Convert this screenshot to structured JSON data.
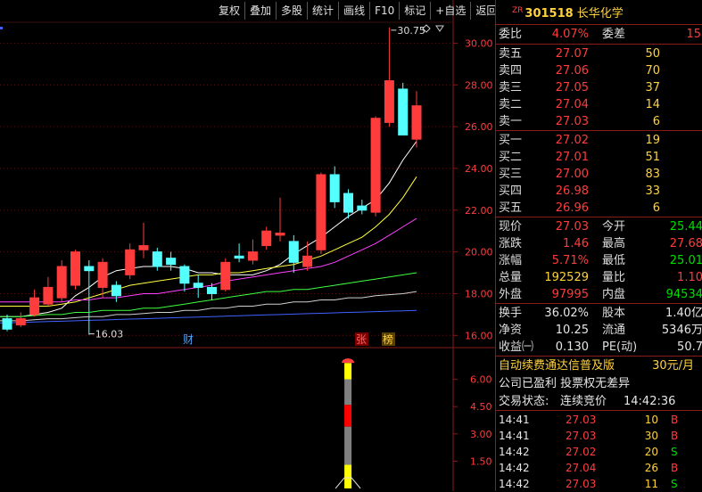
{
  "toolbar": {
    "buttons": [
      "复权",
      "叠加",
      "多股",
      "统计",
      "画线",
      "F10",
      "标记",
      "+自选",
      "返回"
    ]
  },
  "chart": {
    "price_labels": [
      "30.00",
      "28.00",
      "26.00",
      "24.00",
      "22.00",
      "20.00",
      "18.00",
      "16.00"
    ],
    "high_label": "30.75",
    "low_label": "16.03",
    "markers": [
      "财",
      "张",
      "榜"
    ],
    "indicator_labels": [
      "6.00",
      "4.50",
      "3.00",
      "1.50"
    ]
  },
  "stock": {
    "zr": "ZR",
    "code": "301518",
    "name": "长华化学"
  },
  "weibi": {
    "label": "委比",
    "value": "4.07%",
    "label2": "委差",
    "value2": "15"
  },
  "asks": [
    {
      "label": "卖五",
      "price": "27.07",
      "vol": "50"
    },
    {
      "label": "卖四",
      "price": "27.06",
      "vol": "70"
    },
    {
      "label": "卖三",
      "price": "27.05",
      "vol": "37"
    },
    {
      "label": "卖二",
      "price": "27.04",
      "vol": "14"
    },
    {
      "label": "卖一",
      "price": "27.03",
      "vol": "6"
    }
  ],
  "bids": [
    {
      "label": "买一",
      "price": "27.02",
      "vol": "19"
    },
    {
      "label": "买二",
      "price": "27.01",
      "vol": "51"
    },
    {
      "label": "买三",
      "price": "27.00",
      "vol": "83"
    },
    {
      "label": "买四",
      "price": "26.98",
      "vol": "33"
    },
    {
      "label": "买五",
      "price": "26.96",
      "vol": "6"
    }
  ],
  "quote": [
    {
      "l1": "现价",
      "v1": "27.03",
      "c1": "red",
      "l2": "今开",
      "v2": "25.44",
      "c2": "green"
    },
    {
      "l1": "涨跌",
      "v1": "1.46",
      "c1": "red",
      "l2": "最高",
      "v2": "27.68",
      "c2": "red"
    },
    {
      "l1": "涨幅",
      "v1": "5.71%",
      "c1": "red",
      "l2": "最低",
      "v2": "25.01",
      "c2": "green"
    },
    {
      "l1": "总量",
      "v1": "192529",
      "c1": "yellow",
      "l2": "量比",
      "v2": "1.10",
      "c2": "red"
    },
    {
      "l1": "外盘",
      "v1": "97995",
      "c1": "red",
      "l2": "内盘",
      "v2": "94534",
      "c2": "green"
    }
  ],
  "fundamentals": [
    {
      "l1": "换手",
      "v1": "36.02%",
      "l2": "股本",
      "v2": "1.40亿"
    },
    {
      "l1": "净资",
      "v1": "10.25",
      "l2": "流通",
      "v2": "5346万"
    },
    {
      "l1": "收益㈠",
      "v1": "0.130",
      "l2": "PE(动)",
      "v2": "50.7"
    }
  ],
  "promo": {
    "text": "自动续费通达信普及版",
    "price": "30元/月"
  },
  "company_note": "公司已盈利 投票权无差异",
  "trade_status": {
    "label": "交易状态:",
    "status": "连续竞价",
    "time": "14:42:36"
  },
  "ticks": [
    {
      "time": "14:41",
      "price": "27.03",
      "vol": "10",
      "bs": "B",
      "bs_color": "red"
    },
    {
      "time": "14:41",
      "price": "27.03",
      "vol": "30",
      "bs": "B",
      "bs_color": "red"
    },
    {
      "time": "14:42",
      "price": "27.02",
      "vol": "20",
      "bs": "S",
      "bs_color": "green"
    },
    {
      "time": "14:42",
      "price": "27.04",
      "vol": "26",
      "bs": "B",
      "bs_color": "red"
    },
    {
      "time": "14:42",
      "price": "27.03",
      "vol": "11",
      "bs": "S",
      "bs_color": "green"
    }
  ],
  "chart_data": {
    "type": "candlestick",
    "ylim": [
      15.5,
      31
    ],
    "candles": [
      {
        "o": 16.8,
        "c": 16.3,
        "h": 17.0,
        "l": 16.2
      },
      {
        "o": 16.5,
        "c": 16.8,
        "h": 17.1,
        "l": 16.4
      },
      {
        "o": 17.0,
        "c": 17.8,
        "h": 18.2,
        "l": 16.9
      },
      {
        "o": 17.5,
        "c": 18.3,
        "h": 18.8,
        "l": 17.4
      },
      {
        "o": 17.8,
        "c": 19.3,
        "h": 19.6,
        "l": 17.6
      },
      {
        "o": 18.4,
        "c": 20.0,
        "h": 20.1,
        "l": 18.2
      },
      {
        "o": 19.3,
        "c": 19.1,
        "h": 19.6,
        "l": 16.03
      },
      {
        "o": 18.3,
        "c": 19.5,
        "h": 19.7,
        "l": 17.8
      },
      {
        "o": 18.4,
        "c": 17.9,
        "h": 18.6,
        "l": 17.6
      },
      {
        "o": 18.9,
        "c": 20.1,
        "h": 20.4,
        "l": 18.7
      },
      {
        "o": 20.1,
        "c": 20.3,
        "h": 21.4,
        "l": 19.7
      },
      {
        "o": 20.0,
        "c": 19.3,
        "h": 20.2,
        "l": 19.1
      },
      {
        "o": 19.7,
        "c": 19.4,
        "h": 20.0,
        "l": 19.1
      },
      {
        "o": 19.3,
        "c": 18.5,
        "h": 19.4,
        "l": 18.1
      },
      {
        "o": 18.5,
        "c": 18.3,
        "h": 18.9,
        "l": 17.8
      },
      {
        "o": 18.3,
        "c": 18.0,
        "h": 18.5,
        "l": 17.7
      },
      {
        "o": 18.2,
        "c": 19.5,
        "h": 19.7,
        "l": 18.1
      },
      {
        "o": 19.8,
        "c": 19.7,
        "h": 20.4,
        "l": 19.5
      },
      {
        "o": 19.6,
        "c": 20.0,
        "h": 20.6,
        "l": 19.4
      },
      {
        "o": 20.3,
        "c": 21.0,
        "h": 21.2,
        "l": 20.1
      },
      {
        "o": 20.8,
        "c": 20.9,
        "h": 22.6,
        "l": 20.5
      },
      {
        "o": 20.5,
        "c": 19.5,
        "h": 20.8,
        "l": 19.0
      },
      {
        "o": 19.3,
        "c": 19.8,
        "h": 20.5,
        "l": 19.1
      },
      {
        "o": 20.1,
        "c": 23.7,
        "h": 23.8,
        "l": 19.9
      },
      {
        "o": 23.7,
        "c": 22.4,
        "h": 24.1,
        "l": 22.1
      },
      {
        "o": 22.8,
        "c": 21.9,
        "h": 23.0,
        "l": 21.6
      },
      {
        "o": 22.2,
        "c": 22.0,
        "h": 22.5,
        "l": 21.8
      },
      {
        "o": 21.9,
        "c": 26.4,
        "h": 26.5,
        "l": 21.7
      },
      {
        "o": 26.2,
        "c": 28.2,
        "h": 30.75,
        "l": 26.0
      },
      {
        "o": 27.8,
        "c": 25.6,
        "h": 28.1,
        "l": 25.6
      },
      {
        "o": 25.4,
        "c": 27.0,
        "h": 27.7,
        "l": 25.0
      }
    ],
    "ma_lines": [
      {
        "name": "MA5",
        "color": "#ffffff",
        "values": [
          16.9,
          16.9,
          17.0,
          17.1,
          17.3,
          17.9,
          18.3,
          18.8,
          19.1,
          19.2,
          19.3,
          19.3,
          19.3,
          19.2,
          19.0,
          19.0,
          18.9,
          18.9,
          18.9,
          19.1,
          19.4,
          19.9,
          20.3,
          20.7,
          21.2,
          21.7,
          22.1,
          22.5,
          23.3,
          24.4,
          25.3
        ]
      },
      {
        "name": "MA10",
        "color": "#ffff40",
        "values": [
          17.4,
          17.4,
          17.4,
          17.4,
          17.5,
          17.6,
          17.8,
          18.0,
          18.2,
          18.4,
          18.5,
          18.6,
          18.7,
          18.8,
          18.9,
          18.9,
          19.0,
          19.0,
          19.1,
          19.2,
          19.3,
          19.4,
          19.6,
          19.8,
          20.1,
          20.4,
          20.7,
          21.2,
          21.8,
          22.6,
          23.6
        ]
      },
      {
        "name": "MA20",
        "color": "#ff40ff",
        "values": [
          17.6,
          17.6,
          17.6,
          17.6,
          17.6,
          17.7,
          17.7,
          17.8,
          17.8,
          17.9,
          18.0,
          18.0,
          18.1,
          18.2,
          18.3,
          18.4,
          18.6,
          18.7,
          18.8,
          18.9,
          19.0,
          19.1,
          19.2,
          19.3,
          19.5,
          19.8,
          20.1,
          20.4,
          20.8,
          21.2,
          21.6
        ]
      },
      {
        "name": "MA30",
        "color": "#40ff40",
        "values": [
          16.9,
          16.9,
          16.95,
          17.0,
          17.0,
          17.1,
          17.1,
          17.2,
          17.2,
          17.2,
          17.3,
          17.3,
          17.4,
          17.5,
          17.6,
          17.7,
          17.8,
          17.9,
          18.0,
          18.1,
          18.1,
          18.2,
          18.2,
          18.3,
          18.4,
          18.5,
          18.6,
          18.7,
          18.8,
          18.9,
          19.0
        ]
      },
      {
        "name": "MA60",
        "color": "#d0d0d0",
        "values": [
          16.7,
          16.7,
          16.75,
          16.8,
          16.8,
          16.85,
          16.9,
          16.9,
          17.0,
          17.0,
          17.05,
          17.1,
          17.1,
          17.2,
          17.2,
          17.3,
          17.3,
          17.4,
          17.4,
          17.5,
          17.5,
          17.6,
          17.6,
          17.7,
          17.7,
          17.8,
          17.8,
          17.9,
          17.95,
          18.0,
          18.1
        ]
      },
      {
        "name": "MA120",
        "color": "#4060ff",
        "values": [
          16.6,
          16.62,
          16.64,
          16.66,
          16.68,
          16.7,
          16.72,
          16.74,
          16.76,
          16.78,
          16.8,
          16.82,
          16.84,
          16.86,
          16.88,
          16.9,
          16.92,
          16.94,
          16.96,
          16.98,
          17.0,
          17.02,
          17.04,
          17.06,
          17.08,
          17.1,
          17.12,
          17.14,
          17.16,
          17.18,
          17.2
        ]
      }
    ],
    "indicator": {
      "ylim": [
        0,
        7.5
      ],
      "bar_index": 27,
      "segments": [
        {
          "from": 0.0,
          "to": 1.3,
          "color": "#ffff00"
        },
        {
          "from": 1.3,
          "to": 3.4,
          "color": "#808080"
        },
        {
          "from": 3.4,
          "to": 4.6,
          "color": "#ff0000"
        },
        {
          "from": 4.6,
          "to": 6.0,
          "color": "#808080"
        },
        {
          "from": 6.0,
          "to": 6.9,
          "color": "#ffff00"
        }
      ],
      "top_value": 7.1
    }
  }
}
